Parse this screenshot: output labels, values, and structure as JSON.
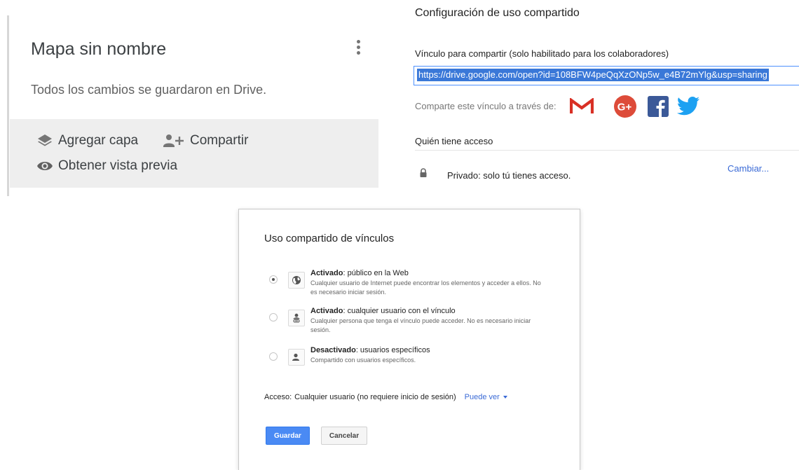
{
  "map_panel": {
    "title": "Mapa sin nombre",
    "status": "Todos los cambios se guardaron en Drive.",
    "actions": {
      "add_layer": "Agregar capa",
      "share": "Compartir",
      "preview": "Obtener vista previa"
    },
    "icons": [
      "layers-icon",
      "add-person-icon",
      "eye-icon",
      "more-vert-icon"
    ]
  },
  "sharing_settings": {
    "title": "Configuración de uso compartido",
    "link_label": "Vínculo para compartir (solo habilitado para los colaboradores)",
    "link_value": "https://drive.google.com/open?id=108BFW4peQqXzONp5w_e4B72mYlg&usp=sharing",
    "share_via_label": "Comparte este vínculo a través de:",
    "social": [
      "gmail-icon",
      "google-plus-icon",
      "facebook-icon",
      "twitter-icon"
    ],
    "who_has_access": "Quién tiene acceso",
    "private_text": "Privado: solo tú tienes acceso.",
    "change_link": "Cambiar..."
  },
  "link_sharing_dialog": {
    "title": "Uso compartido de vínculos",
    "options": [
      {
        "label_bold": "Activado",
        "label_rest": ": público en la Web",
        "description": "Cualquier usuario de Internet puede encontrar los elementos y acceder a ellos. No es necesario iniciar sesión.",
        "icon": "globe-icon",
        "selected": true
      },
      {
        "label_bold": "Activado",
        "label_rest": ": cualquier usuario con el vínculo",
        "description": "Cualquier persona que tenga el vínculo puede acceder. No es necesario iniciar sesión.",
        "icon": "person-link-icon",
        "selected": false
      },
      {
        "label_bold": "Desactivado",
        "label_rest": ": usuarios específicos",
        "description": "Compartido con usuarios específicos.",
        "icon": "person-icon",
        "selected": false
      }
    ],
    "access_label": "Acceso:",
    "access_value": "Cualquier usuario (no requiere inicio de sesión)",
    "permission": "Puede ver",
    "save": "Guardar",
    "cancel": "Cancelar"
  },
  "colors": {
    "link_selection": "#3a78d8",
    "link_text": "#3a6ad6",
    "primary_button": "#4a8af4",
    "gmail": "#d93025",
    "google_plus": "#dd4b39",
    "facebook": "#3b5998",
    "twitter": "#1da1f2"
  }
}
